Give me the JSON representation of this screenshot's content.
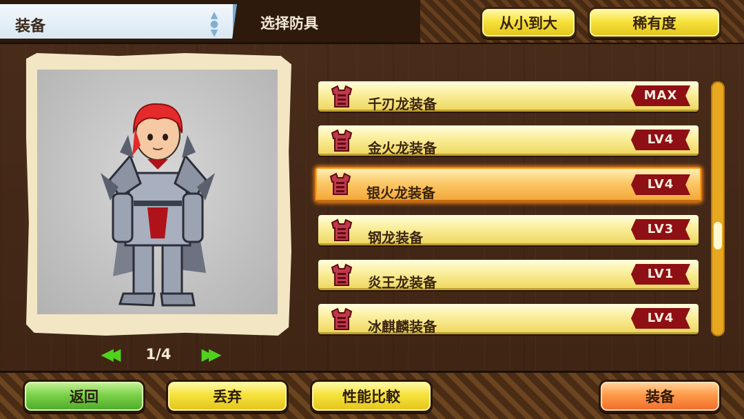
{
  "header": {
    "title": "装备",
    "subtitle": "选择防具",
    "sort_buttons": [
      {
        "label": "从小到大"
      },
      {
        "label": "稀有度"
      }
    ]
  },
  "preview": {
    "page": "1/4",
    "prev_icon": "double-chevron-left-icon",
    "next_icon": "double-chevron-right-icon"
  },
  "equipment_list": {
    "items": [
      {
        "name": "千刃龙装备",
        "level": "MAX",
        "selected": false,
        "icon": "armor-chest-icon"
      },
      {
        "name": "金火龙装备",
        "level": "LV4",
        "selected": false,
        "icon": "armor-chest-icon"
      },
      {
        "name": "银火龙装备",
        "level": "LV4",
        "selected": true,
        "icon": "armor-chest-icon"
      },
      {
        "name": "钢龙装备",
        "level": "LV3",
        "selected": false,
        "icon": "armor-chest-icon"
      },
      {
        "name": "炎王龙装备",
        "level": "LV1",
        "selected": false,
        "icon": "armor-chest-icon"
      },
      {
        "name": "冰麒麟装备",
        "level": "LV4",
        "selected": false,
        "icon": "armor-chest-icon"
      }
    ],
    "scroll_position": 0.62
  },
  "footer": {
    "back": "返回",
    "discard": "丢弃",
    "compare": "性能比較",
    "equip": "装备"
  },
  "colors": {
    "wood": "#4a2c1a",
    "button_yellow": "#f6e23c",
    "button_green": "#7cd24a",
    "button_orange": "#ff9a4a",
    "selected_glow": "#ff8c1a",
    "level_badge": "#8e0f14",
    "pager_arrow": "#4ed21c"
  }
}
